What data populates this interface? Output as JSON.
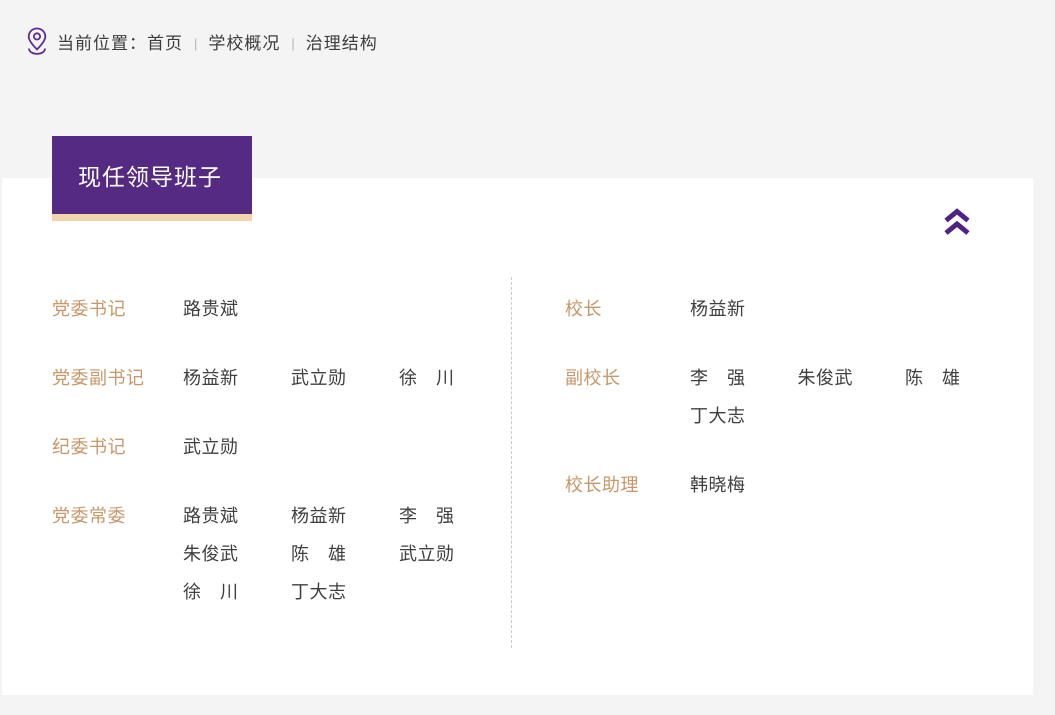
{
  "breadcrumb": {
    "location_label": "当前位置：",
    "separator": "|",
    "items": [
      {
        "label": "首页"
      },
      {
        "label": "学校概况"
      },
      {
        "label": "治理结构"
      }
    ]
  },
  "section": {
    "title": "现任领导班子"
  },
  "icons": {
    "location_pin": "location-pin-icon",
    "collapse": "chevron-double-up-icon"
  },
  "colors": {
    "purple": "#552a82",
    "beige_underline": "#f2d5ac",
    "role_label_tan": "#c8976a",
    "text_dark": "#3f3f3f",
    "page_background": "#f5f4f5",
    "card_background": "#ffffff"
  },
  "leadership": {
    "left_column": [
      {
        "role": "党委书记",
        "names": [
          "路贵斌"
        ]
      },
      {
        "role": "党委副书记",
        "names": [
          "杨益新",
          "武立勋",
          "徐　川"
        ]
      },
      {
        "role": "纪委书记",
        "names": [
          "武立勋"
        ]
      },
      {
        "role": "党委常委",
        "names": [
          "路贵斌",
          "杨益新",
          "李　强",
          "朱俊武",
          "陈　雄",
          "武立勋",
          "徐　川",
          "丁大志"
        ]
      }
    ],
    "right_column": [
      {
        "role": "校长",
        "names": [
          "杨益新"
        ]
      },
      {
        "role": "副校长",
        "names": [
          "李　强",
          "朱俊武",
          "陈　雄",
          "丁大志"
        ]
      },
      {
        "role": "校长助理",
        "names": [
          "韩晓梅"
        ]
      }
    ]
  }
}
